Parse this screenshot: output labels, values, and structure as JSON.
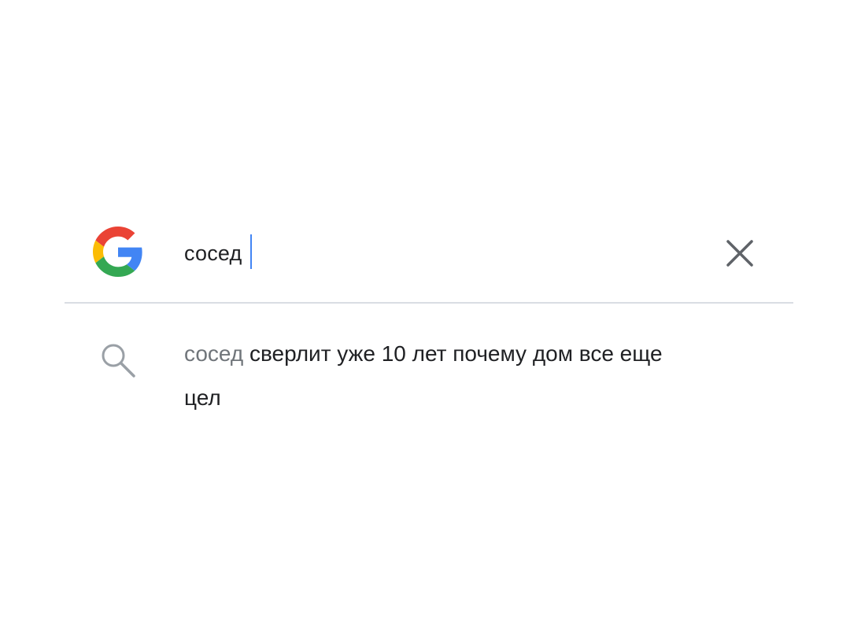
{
  "search": {
    "logo_icon": "google-g-icon",
    "query": "сосед",
    "clear_icon": "close-icon"
  },
  "suggestions": [
    {
      "icon": "search-icon",
      "prefix": "сосед",
      "completion": " сверлит уже 10 лет почему дом все еще цел"
    }
  ],
  "colors": {
    "google_blue": "#4285F4",
    "google_red": "#EA4335",
    "google_yellow": "#FBBC05",
    "google_green": "#34A853",
    "text": "#202124",
    "muted_text": "#70757a",
    "divider": "#d9dde3"
  }
}
